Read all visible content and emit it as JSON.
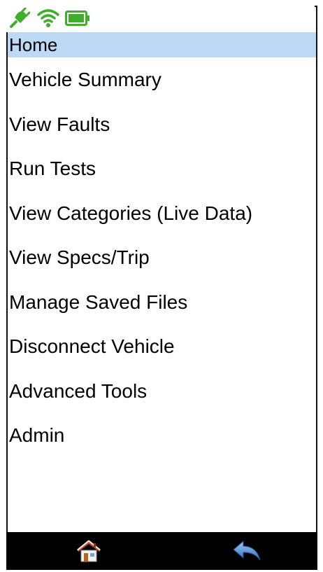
{
  "status_bar": {
    "icons": [
      "plug-connected-icon",
      "wifi-signal-icon",
      "battery-icon"
    ],
    "accent_color": "#3fae2a"
  },
  "header": {
    "title": "Home",
    "highlight_color": "#bcd9f5"
  },
  "menu": {
    "items": [
      {
        "label": "Vehicle Summary"
      },
      {
        "label": "View Faults"
      },
      {
        "label": "Run Tests"
      },
      {
        "label": "View Categories (Live Data)"
      },
      {
        "label": "View Specs/Trip"
      },
      {
        "label": "Manage Saved Files"
      },
      {
        "label": "Disconnect Vehicle"
      },
      {
        "label": "Advanced Tools"
      },
      {
        "label": "Admin"
      }
    ]
  },
  "bottom_nav": {
    "buttons": [
      "home-icon",
      "back-arrow-icon"
    ],
    "background_color": "#000000"
  }
}
